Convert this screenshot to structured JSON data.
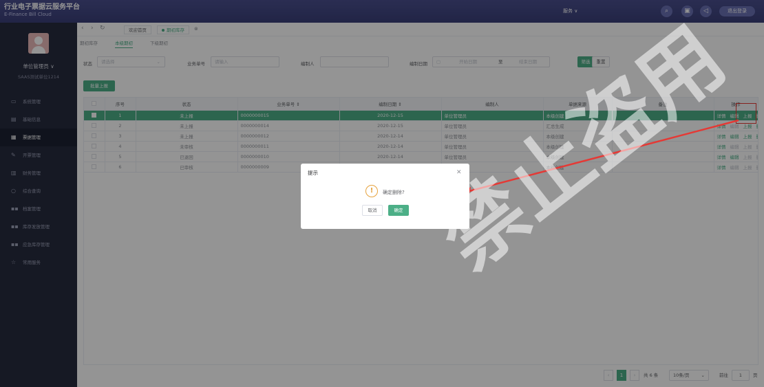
{
  "header": {
    "title": "行业电子票据云服务平台",
    "subtitle": "E-Finance Bill Cloud",
    "service_menu": "服务",
    "logout": "退出登录"
  },
  "sidebar": {
    "user_name": "单位管理员 ∨",
    "org": "SAAS测试单位1214",
    "items": [
      {
        "label": "系统管理",
        "icon": "monitor-icon"
      },
      {
        "label": "基础信息",
        "icon": "info-card-icon"
      },
      {
        "label": "票据管理",
        "icon": "bill-icon"
      },
      {
        "label": "开票管理",
        "icon": "edit-icon"
      },
      {
        "label": "财务管理",
        "icon": "finance-icon"
      },
      {
        "label": "综合查询",
        "icon": "search-icon"
      },
      {
        "label": "档案管理",
        "icon": "grid-icon"
      },
      {
        "label": "库存发放管理",
        "icon": "grid-icon"
      },
      {
        "label": "应急库存管理",
        "icon": "grid-icon"
      },
      {
        "label": "常用服务",
        "icon": "star-icon"
      }
    ]
  },
  "tabs": {
    "home": "欢迎首页",
    "current": "期初库存"
  },
  "subtabs": {
    "breadcrumb": "期初库存",
    "own": "本级期初",
    "lower": "下级期初"
  },
  "filters": {
    "status_label": "状态",
    "status_placeholder": "请选择",
    "doc_no_label": "业务单号",
    "doc_no_placeholder": "请输入",
    "creator_label": "编制人",
    "date_label": "编制日期",
    "date_start": "开始日期",
    "date_to": "至",
    "date_end": "结束日期",
    "search_btn": "筛选",
    "reset_btn": "重置"
  },
  "batch_btn": "批量上报",
  "table": {
    "columns": [
      "序号",
      "状态",
      "业务单号 ⇕",
      "编制日期 ⇕",
      "编制人",
      "单据来源",
      "备注",
      "操作"
    ],
    "rows": [
      {
        "no": "1",
        "status": "未上报",
        "doc_no": "0000000015",
        "date": "2020-12-15",
        "creator": "单位管理员",
        "source": "本级创建",
        "remark": ""
      },
      {
        "no": "2",
        "status": "未上报",
        "doc_no": "0000000014",
        "date": "2020-12-15",
        "creator": "单位管理员",
        "source": "汇总生成",
        "remark": ""
      },
      {
        "no": "3",
        "status": "未上报",
        "doc_no": "0000000012",
        "date": "2020-12-14",
        "creator": "单位管理员",
        "source": "本级创建",
        "remark": ""
      },
      {
        "no": "4",
        "status": "未审核",
        "doc_no": "0000000011",
        "date": "2020-12-14",
        "creator": "单位管理员",
        "source": "本级创建",
        "remark": ""
      },
      {
        "no": "5",
        "status": "已退回",
        "doc_no": "0000000010",
        "date": "2020-12-14",
        "creator": "单位管理员",
        "source": "本级创建",
        "remark": ""
      },
      {
        "no": "6",
        "status": "已审核",
        "doc_no": "0000000009",
        "date": "2020-12-14",
        "creator": "单位管理员",
        "source": "本级创建",
        "remark": ""
      }
    ],
    "actions": {
      "detail": "详情",
      "edit": "编辑",
      "report": "上报",
      "delete": "删除"
    }
  },
  "pagination": {
    "current": "1",
    "total": "共 6 条",
    "page_size": "10条/页",
    "goto_label": "前往",
    "goto_value": "1",
    "page_unit": "页"
  },
  "dialog": {
    "title": "提示",
    "message": "确定删除?",
    "cancel": "取消",
    "confirm": "确定"
  },
  "watermark": "禁止盗用",
  "colors": {
    "primary": "#4caf87",
    "header": "#3f447f",
    "sidebar": "#262b3e",
    "annotation": "#e53935"
  }
}
